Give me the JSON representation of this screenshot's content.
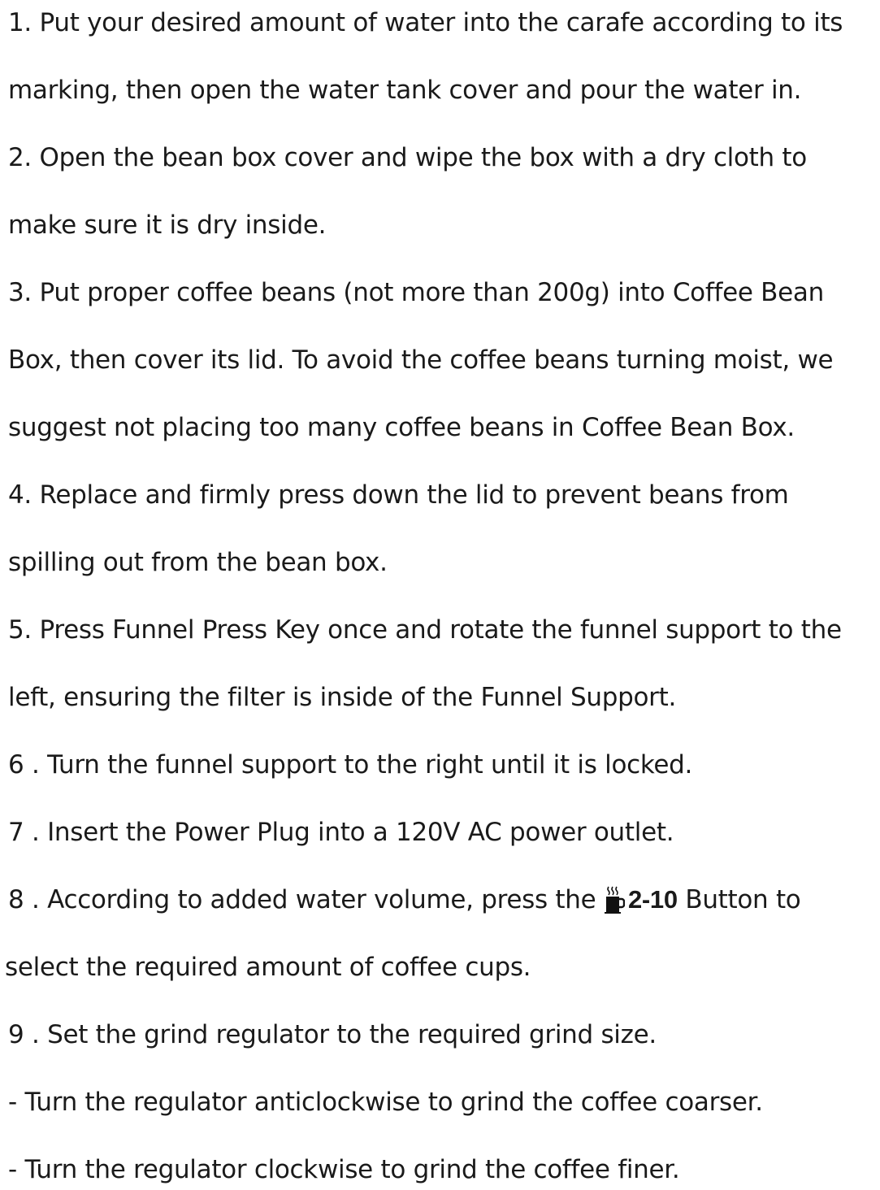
{
  "instructions": {
    "lines": [
      "1. Put your desired amount of water into the carafe according to its",
      "marking, then open the water tank cover  and pour the water in.",
      "2. Open the bean box cover and wipe the box with a dry cloth to",
      "make sure it is dry inside.",
      "3. Put proper coffee beans (not more than 200g) into Coffee Bean",
      "Box, then cover its lid. To avoid the coffee beans turning moist, we",
      "suggest not placing too many coffee beans in Coffee Bean Box.",
      "4. Replace and firmly press down the lid to prevent beans from",
      "spilling out from the bean box.",
      "5. Press Funnel Press Key once and rotate the funnel support to the",
      "left, ensuring the filter is inside of the Funnel Support.",
      "6 . Turn the funnel support to the right until it is locked.",
      "7 . Insert the Power Plug into a 120V AC power outlet."
    ],
    "step8": {
      "before": "8 . According to added water volume, press the ",
      "icon": "coffee-cup-icon",
      "button_label": "2-10",
      "after": " Button to"
    },
    "lines_after": [
      "select the required amount of coffee cups.",
      "9 . Set the grind regulator to the required grind size.",
      "- Turn the regulator anticlockwise to grind the coffee coarser.",
      "- Turn the regulator clockwise to grind the coffee finer."
    ]
  }
}
